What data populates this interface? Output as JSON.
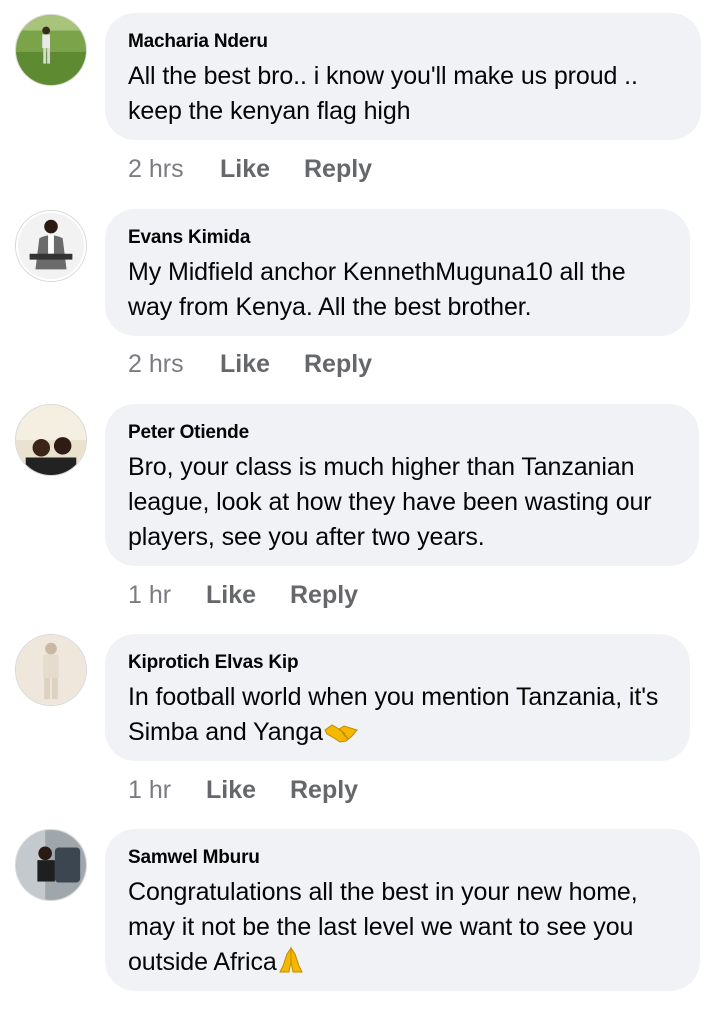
{
  "comments": [
    {
      "author": "Macharia Nderu",
      "text": "All the best bro.. i know you'll make us proud .. keep the kenyan flag high",
      "time": "2 hrs",
      "like_label": "Like",
      "reply_label": "Reply",
      "avatar_icon": "profile-photo-icon"
    },
    {
      "author": "Evans Kimida",
      "text": "My Midfield anchor KennethMuguna10 all the way from Kenya. All the best brother.",
      "time": "2 hrs",
      "like_label": "Like",
      "reply_label": "Reply",
      "avatar_icon": "profile-photo-icon"
    },
    {
      "author": "Peter Otiende",
      "text": "Bro, your class is much higher than Tanzanian league, look at how they have been wasting our players, see you after two years.",
      "time": "1 hr",
      "like_label": "Like",
      "reply_label": "Reply",
      "avatar_icon": "profile-photo-icon"
    },
    {
      "author": "Kiprotich Elvas Kip",
      "text": "In football world when you mention Tanzania, it's Simba and Yanga",
      "emoji": "handshake-emoji",
      "time": "1 hr",
      "like_label": "Like",
      "reply_label": "Reply",
      "avatar_icon": "profile-photo-icon"
    },
    {
      "author": "Samwel Mburu",
      "text": "Congratulations all the best in your new home, may it not be the last level we want to see you outside Africa",
      "emoji": "folded-hands-emoji",
      "avatar_icon": "profile-photo-icon"
    }
  ],
  "colors": {
    "bubble": "#f0f2f5",
    "text": "#050505",
    "meta": "#65676b",
    "emoji": "#f5b800"
  }
}
